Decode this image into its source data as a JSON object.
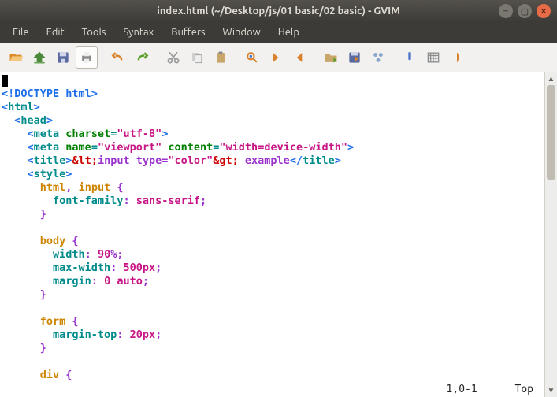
{
  "window": {
    "title": "index.html (~/Desktop/js/01 basic/02 basic) - GVIM"
  },
  "menu": {
    "items": [
      "File",
      "Edit",
      "Tools",
      "Syntax",
      "Buffers",
      "Window",
      "Help"
    ]
  },
  "toolbar": {
    "icons": [
      {
        "name": "open-icon",
        "group": 1
      },
      {
        "name": "save-icon",
        "group": 1
      },
      {
        "name": "save-all-icon",
        "group": 1
      },
      {
        "name": "print-icon",
        "group": 1
      },
      {
        "name": "undo-icon",
        "group": 2
      },
      {
        "name": "redo-icon",
        "group": 2
      },
      {
        "name": "cut-icon",
        "group": 3
      },
      {
        "name": "copy-icon",
        "group": 3
      },
      {
        "name": "paste-icon",
        "group": 3
      },
      {
        "name": "find-replace-icon",
        "group": 4
      },
      {
        "name": "find-next-icon",
        "group": 4
      },
      {
        "name": "find-prev-icon",
        "group": 4
      },
      {
        "name": "load-session-icon",
        "group": 5
      },
      {
        "name": "save-session-icon",
        "group": 5
      },
      {
        "name": "run-script-icon",
        "group": 5
      },
      {
        "name": "make-icon",
        "group": 6
      },
      {
        "name": "shell-icon",
        "group": 6
      },
      {
        "name": "tag-jump-icon",
        "group": 6
      }
    ]
  },
  "code": {
    "lines": [
      {
        "segs": [
          {
            "t": "<!DOCTYPE html>",
            "c": "c-blue"
          }
        ]
      },
      {
        "segs": [
          {
            "t": "<",
            "c": "c-blue"
          },
          {
            "t": "html",
            "c": "c-teal"
          },
          {
            "t": ">",
            "c": "c-blue"
          }
        ]
      },
      {
        "indent": 1,
        "segs": [
          {
            "t": "<",
            "c": "c-blue"
          },
          {
            "t": "head",
            "c": "c-teal"
          },
          {
            "t": ">",
            "c": "c-blue"
          }
        ]
      },
      {
        "indent": 2,
        "segs": [
          {
            "t": "<",
            "c": "c-blue"
          },
          {
            "t": "meta ",
            "c": "c-teal"
          },
          {
            "t": "charset",
            "c": "c-green"
          },
          {
            "t": "=",
            "c": "c-teal"
          },
          {
            "t": "\"utf-8\"",
            "c": "c-mag"
          },
          {
            "t": ">",
            "c": "c-blue"
          }
        ]
      },
      {
        "indent": 2,
        "segs": [
          {
            "t": "<",
            "c": "c-blue"
          },
          {
            "t": "meta ",
            "c": "c-teal"
          },
          {
            "t": "name",
            "c": "c-green"
          },
          {
            "t": "=",
            "c": "c-teal"
          },
          {
            "t": "\"viewport\"",
            "c": "c-mag"
          },
          {
            "t": " ",
            "c": ""
          },
          {
            "t": "content",
            "c": "c-green"
          },
          {
            "t": "=",
            "c": "c-teal"
          },
          {
            "t": "\"width=device-width\"",
            "c": "c-mag"
          },
          {
            "t": ">",
            "c": "c-blue"
          }
        ]
      },
      {
        "indent": 2,
        "segs": [
          {
            "t": "<",
            "c": "c-blue"
          },
          {
            "t": "title",
            "c": "c-teal"
          },
          {
            "t": ">",
            "c": "c-blue"
          },
          {
            "t": "&lt;",
            "c": "c-red"
          },
          {
            "t": "input type=",
            "c": "c-pur"
          },
          {
            "t": "\"color\"",
            "c": "c-mag"
          },
          {
            "t": "&gt;",
            "c": "c-red"
          },
          {
            "t": " example",
            "c": "c-pur"
          },
          {
            "t": "</",
            "c": "c-blue"
          },
          {
            "t": "title",
            "c": "c-teal"
          },
          {
            "t": ">",
            "c": "c-blue"
          }
        ]
      },
      {
        "indent": 2,
        "segs": [
          {
            "t": "<",
            "c": "c-blue"
          },
          {
            "t": "style",
            "c": "c-teal"
          },
          {
            "t": ">",
            "c": "c-blue"
          }
        ]
      },
      {
        "indent": 3,
        "segs": [
          {
            "t": "html",
            "c": "c-br"
          },
          {
            "t": ", ",
            "c": "c-pur"
          },
          {
            "t": "input",
            "c": "c-br"
          },
          {
            "t": " {",
            "c": "c-pur"
          }
        ]
      },
      {
        "indent": 4,
        "segs": [
          {
            "t": "font-family",
            "c": "c-teal"
          },
          {
            "t": ": ",
            "c": "c-pur"
          },
          {
            "t": "sans-serif",
            "c": "c-mag"
          },
          {
            "t": ";",
            "c": "c-pur"
          }
        ]
      },
      {
        "indent": 3,
        "segs": [
          {
            "t": "}",
            "c": "c-pur"
          }
        ]
      },
      {
        "segs": []
      },
      {
        "indent": 3,
        "segs": [
          {
            "t": "body",
            "c": "c-br"
          },
          {
            "t": " {",
            "c": "c-pur"
          }
        ]
      },
      {
        "indent": 4,
        "segs": [
          {
            "t": "width",
            "c": "c-teal"
          },
          {
            "t": ": ",
            "c": "c-pur"
          },
          {
            "t": "90",
            "c": "c-mag"
          },
          {
            "t": "%;",
            "c": "c-pur"
          }
        ]
      },
      {
        "indent": 4,
        "segs": [
          {
            "t": "max-width",
            "c": "c-teal"
          },
          {
            "t": ": ",
            "c": "c-pur"
          },
          {
            "t": "500px",
            "c": "c-mag"
          },
          {
            "t": ";",
            "c": "c-pur"
          }
        ]
      },
      {
        "indent": 4,
        "segs": [
          {
            "t": "margin",
            "c": "c-teal"
          },
          {
            "t": ": ",
            "c": "c-pur"
          },
          {
            "t": "0",
            "c": "c-mag"
          },
          {
            "t": " ",
            "c": ""
          },
          {
            "t": "auto",
            "c": "c-mag"
          },
          {
            "t": ";",
            "c": "c-pur"
          }
        ]
      },
      {
        "indent": 3,
        "segs": [
          {
            "t": "}",
            "c": "c-pur"
          }
        ]
      },
      {
        "segs": []
      },
      {
        "indent": 3,
        "segs": [
          {
            "t": "form",
            "c": "c-br"
          },
          {
            "t": " {",
            "c": "c-pur"
          }
        ]
      },
      {
        "indent": 4,
        "segs": [
          {
            "t": "margin-top",
            "c": "c-teal"
          },
          {
            "t": ": ",
            "c": "c-pur"
          },
          {
            "t": "20px",
            "c": "c-mag"
          },
          {
            "t": ";",
            "c": "c-pur"
          }
        ]
      },
      {
        "indent": 3,
        "segs": [
          {
            "t": "}",
            "c": "c-pur"
          }
        ]
      },
      {
        "segs": []
      },
      {
        "indent": 3,
        "segs": [
          {
            "t": "div",
            "c": "c-br"
          },
          {
            "t": " {",
            "c": "c-pur"
          }
        ]
      }
    ]
  },
  "status": {
    "position": "1,0-1",
    "scroll": "Top"
  }
}
